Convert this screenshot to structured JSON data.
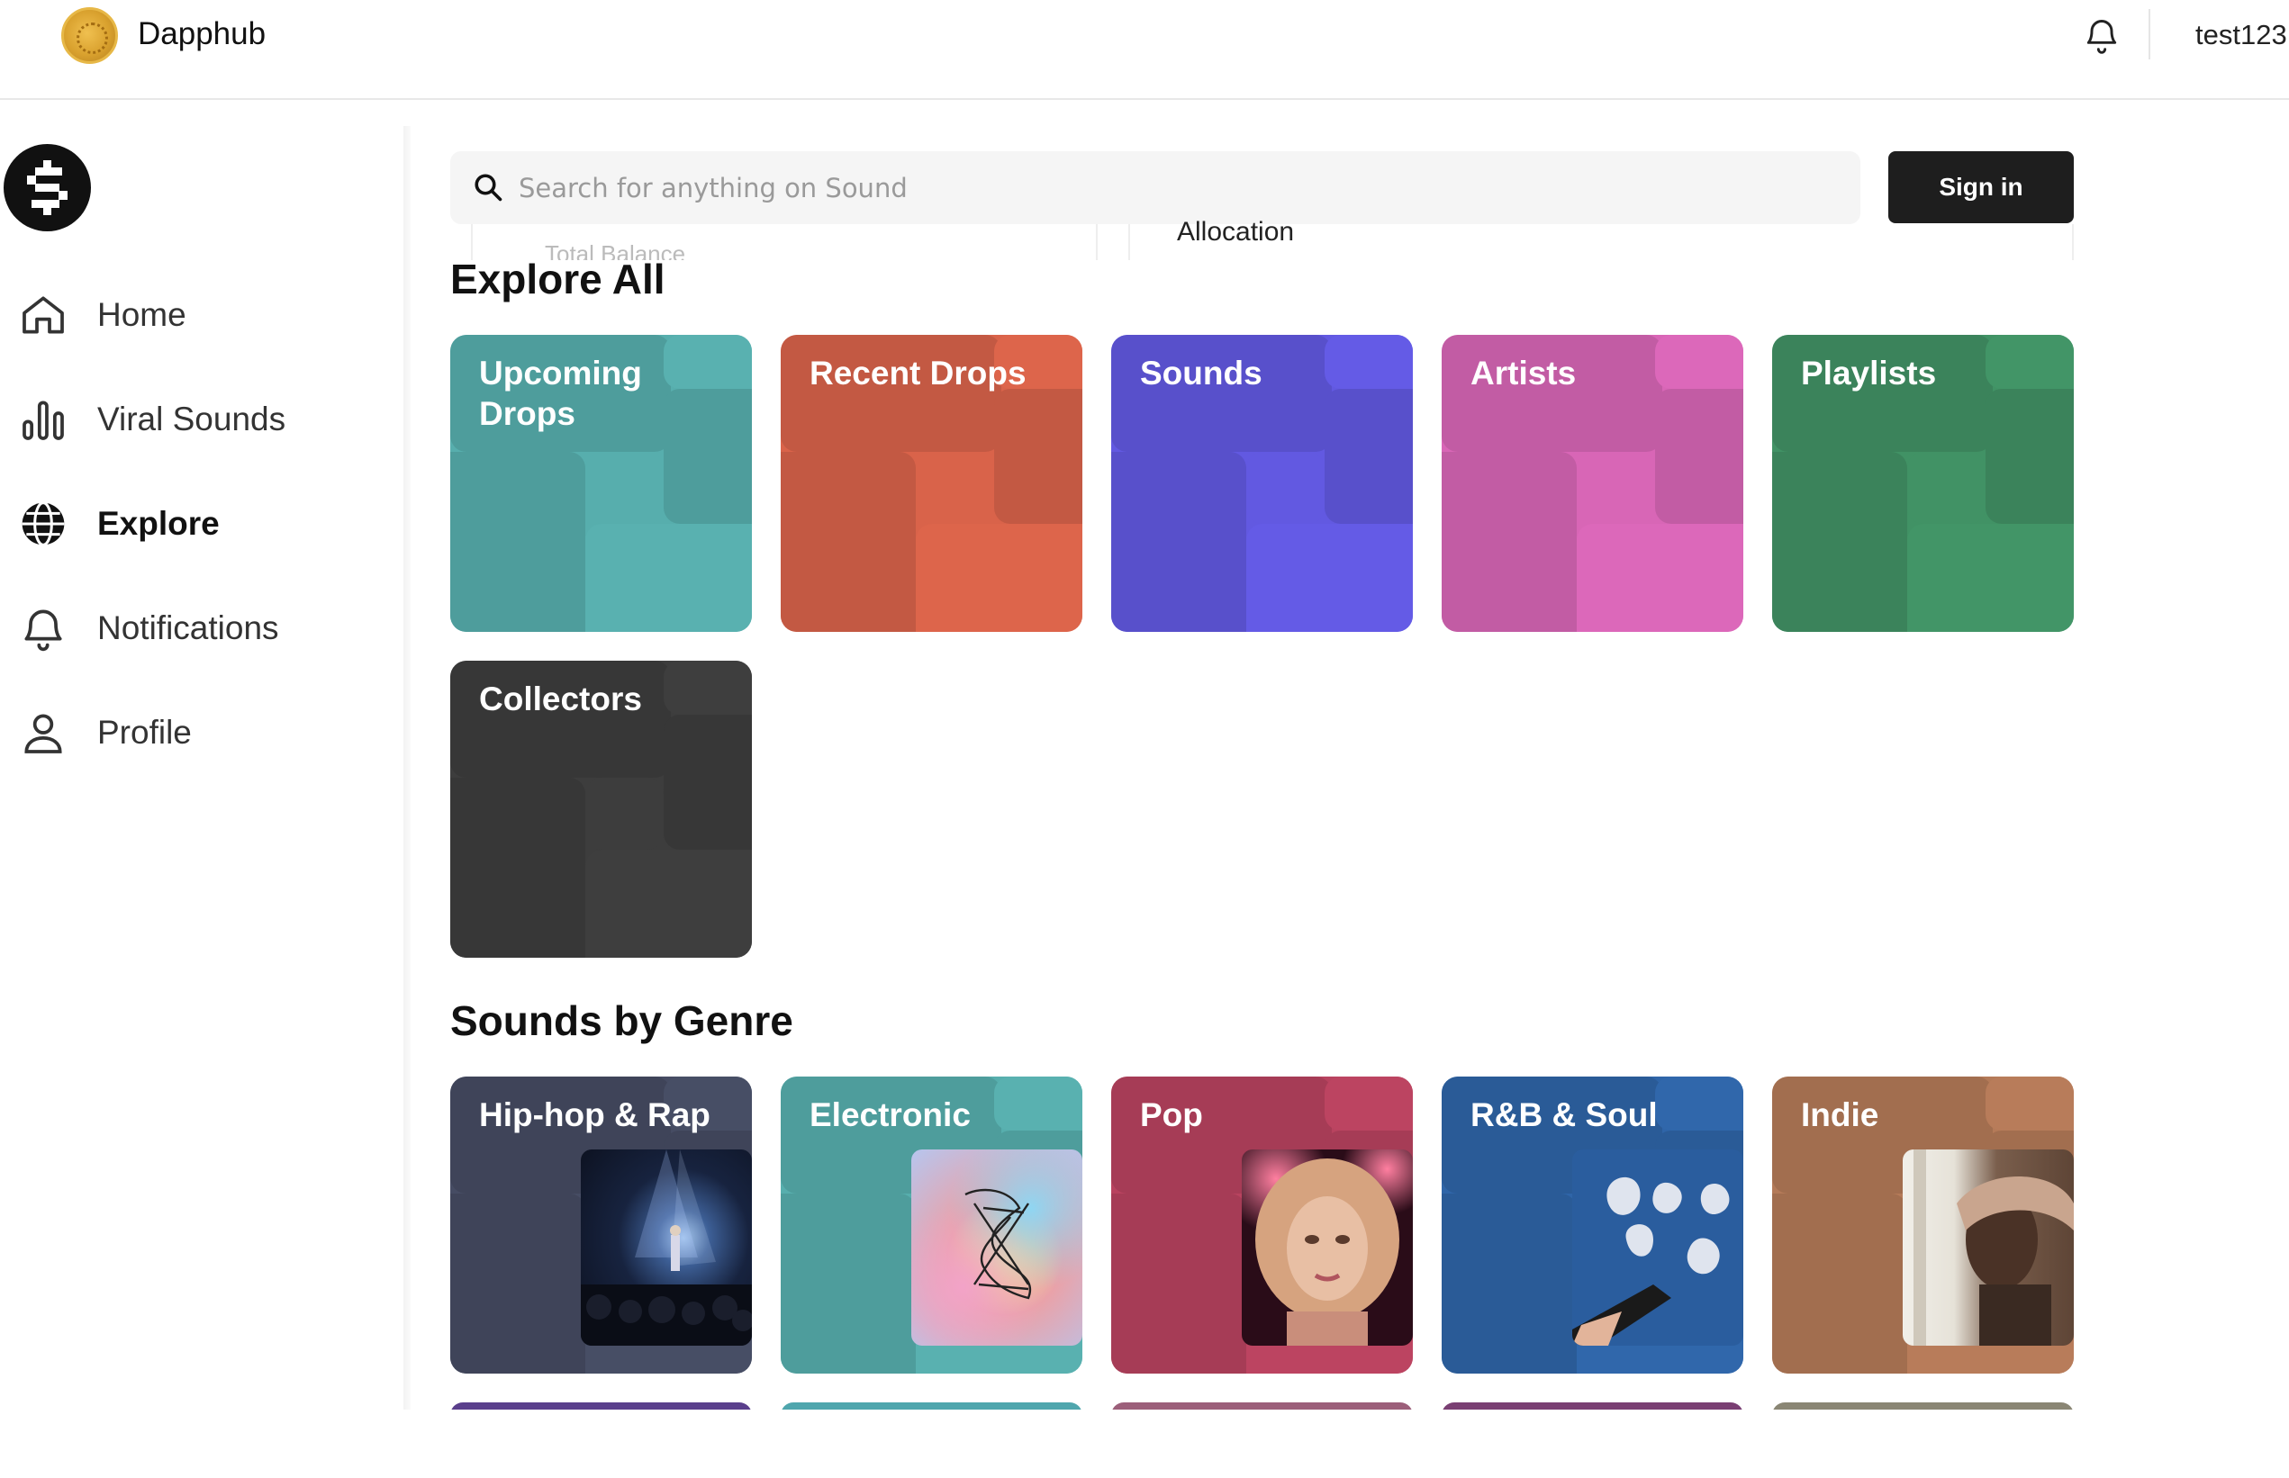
{
  "header": {
    "brand_name": "Dapphub",
    "username": "test123"
  },
  "sidebar": {
    "items": [
      {
        "label": "Home",
        "icon": "home-icon"
      },
      {
        "label": "Viral Sounds",
        "icon": "bar-chart-icon"
      },
      {
        "label": "Explore",
        "icon": "globe-icon",
        "active": true
      },
      {
        "label": "Notifications",
        "icon": "bell-icon"
      },
      {
        "label": "Profile",
        "icon": "user-icon"
      }
    ]
  },
  "search": {
    "placeholder": "Search for anything on Sound",
    "value": ""
  },
  "sign_in_label": "Sign in",
  "background_panel": {
    "total_balance": "Total Balance",
    "allocation": "Allocation"
  },
  "explore": {
    "title": "Explore All",
    "tiles": [
      {
        "label": "Upcoming Drops",
        "color": "#57aead"
      },
      {
        "label": "Recent Drops",
        "color": "#d9634a"
      },
      {
        "label": "Sounds",
        "color": "#6259e1"
      },
      {
        "label": "Artists",
        "color": "#d866b6"
      },
      {
        "label": "Playlists",
        "color": "#419265"
      },
      {
        "label": "Collectors",
        "color": "#3d3d3d"
      }
    ]
  },
  "genres": {
    "title": "Sounds by Genre",
    "tiles": [
      {
        "label": "Hip-hop & Rap",
        "color": "#464c63"
      },
      {
        "label": "Electronic",
        "color": "#57aead"
      },
      {
        "label": "Pop",
        "color": "#b8435f"
      },
      {
        "label": "R&B & Soul",
        "color": "#2f65a8"
      },
      {
        "label": "Indie",
        "color": "#b47a58"
      }
    ]
  }
}
